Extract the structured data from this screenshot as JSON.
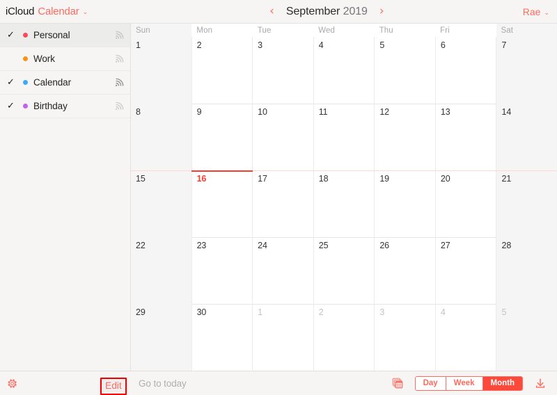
{
  "header": {
    "brand_primary": "iCloud",
    "brand_app": "Calendar",
    "brand_chevron": "⌄",
    "prev_arrow": "‹",
    "next_arrow": "›",
    "month": "September",
    "year": "2019",
    "account_name": "Rae",
    "account_chevron": "⌄"
  },
  "sidebar": {
    "calendars": [
      {
        "label": "Personal",
        "color": "#fb4a5b",
        "checked": true,
        "check": "✓",
        "selected": true,
        "shared_icon": "broadcast-icon",
        "shared_active": false
      },
      {
        "label": "Work",
        "color": "#fb9317",
        "checked": false,
        "check": "✓",
        "selected": false,
        "shared_icon": "broadcast-icon",
        "shared_active": false
      },
      {
        "label": "Calendar",
        "color": "#3fa9f5",
        "checked": true,
        "check": "✓",
        "selected": false,
        "shared_icon": "broadcast-icon",
        "shared_active": true
      },
      {
        "label": "Birthday",
        "color": "#c560e8",
        "checked": true,
        "check": "✓",
        "selected": false,
        "shared_icon": "broadcast-icon",
        "shared_active": false
      }
    ]
  },
  "calendar": {
    "weekday_headers": [
      "Sun",
      "Mon",
      "Tue",
      "Wed",
      "Thu",
      "Fri",
      "Sat"
    ],
    "today_row_index": 2,
    "today_column_index": 1,
    "weeks": [
      [
        {
          "num": "1",
          "other": false,
          "today": false
        },
        {
          "num": "2",
          "other": false,
          "today": false
        },
        {
          "num": "3",
          "other": false,
          "today": false
        },
        {
          "num": "4",
          "other": false,
          "today": false
        },
        {
          "num": "5",
          "other": false,
          "today": false
        },
        {
          "num": "6",
          "other": false,
          "today": false
        },
        {
          "num": "7",
          "other": false,
          "today": false
        }
      ],
      [
        {
          "num": "8",
          "other": false,
          "today": false
        },
        {
          "num": "9",
          "other": false,
          "today": false
        },
        {
          "num": "10",
          "other": false,
          "today": false
        },
        {
          "num": "11",
          "other": false,
          "today": false
        },
        {
          "num": "12",
          "other": false,
          "today": false
        },
        {
          "num": "13",
          "other": false,
          "today": false
        },
        {
          "num": "14",
          "other": false,
          "today": false
        }
      ],
      [
        {
          "num": "15",
          "other": false,
          "today": false
        },
        {
          "num": "16",
          "other": false,
          "today": true
        },
        {
          "num": "17",
          "other": false,
          "today": false
        },
        {
          "num": "18",
          "other": false,
          "today": false
        },
        {
          "num": "19",
          "other": false,
          "today": false
        },
        {
          "num": "20",
          "other": false,
          "today": false
        },
        {
          "num": "21",
          "other": false,
          "today": false
        }
      ],
      [
        {
          "num": "22",
          "other": false,
          "today": false
        },
        {
          "num": "23",
          "other": false,
          "today": false
        },
        {
          "num": "24",
          "other": false,
          "today": false
        },
        {
          "num": "25",
          "other": false,
          "today": false
        },
        {
          "num": "26",
          "other": false,
          "today": false
        },
        {
          "num": "27",
          "other": false,
          "today": false
        },
        {
          "num": "28",
          "other": false,
          "today": false
        }
      ],
      [
        {
          "num": "29",
          "other": false,
          "today": false
        },
        {
          "num": "30",
          "other": false,
          "today": false
        },
        {
          "num": "1",
          "other": true,
          "today": false
        },
        {
          "num": "2",
          "other": true,
          "today": false
        },
        {
          "num": "3",
          "other": true,
          "today": false
        },
        {
          "num": "4",
          "other": true,
          "today": false
        },
        {
          "num": "5",
          "other": true,
          "today": false
        }
      ]
    ]
  },
  "toolbar": {
    "settings_icon": "gear-icon",
    "edit_label": "Edit",
    "edit_highlighted": true,
    "goto_today_label": "Go to today",
    "stack_icon": "calendar-stack-icon",
    "download_icon": "download-arrow-icon",
    "views": [
      {
        "label": "Day",
        "active": false
      },
      {
        "label": "Week",
        "active": false
      },
      {
        "label": "Month",
        "active": true
      }
    ]
  },
  "colors": {
    "accent": "#fb6b60",
    "accent_strong": "#fb4a3c",
    "today_red": "#fb3b2d",
    "highlight_box": "#f00000",
    "chrome_bg": "#f7f5f4",
    "weekend_bg": "#f5f5f5"
  }
}
